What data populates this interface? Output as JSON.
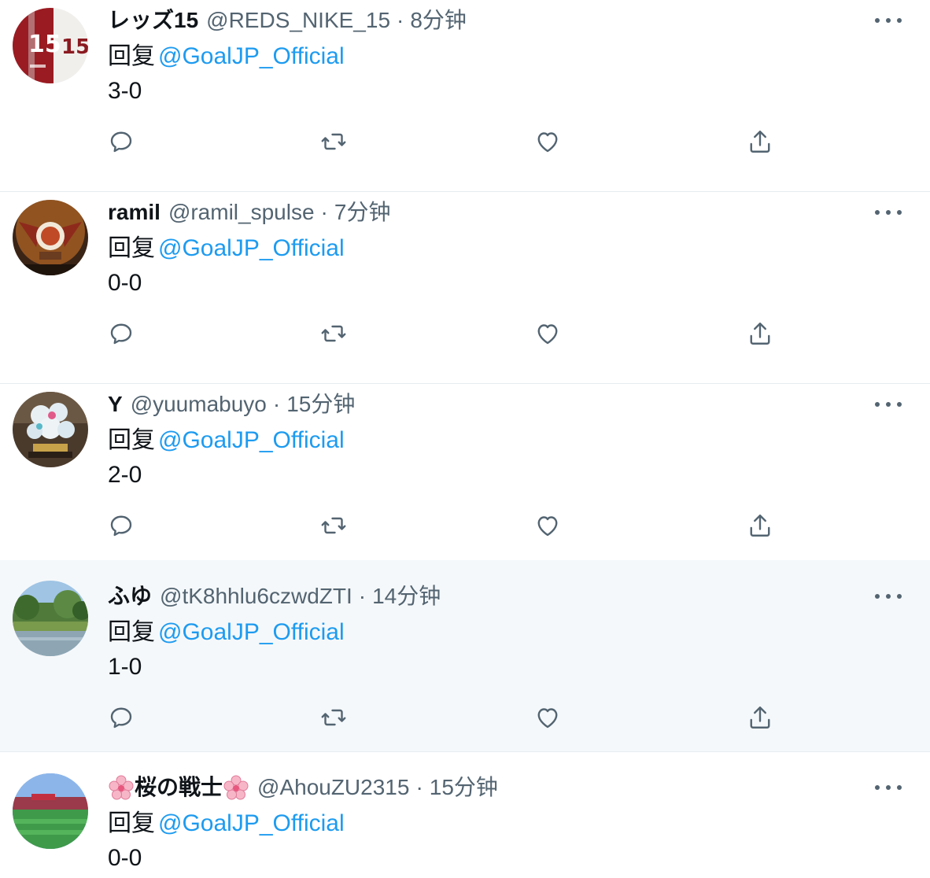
{
  "reply_prefix": "回复",
  "tweets": [
    {
      "display_name": "レッズ15",
      "handle": "@REDS_NIKE_15",
      "time": "8分钟",
      "mention": "@GoalJP_Official",
      "text": "3-0",
      "avatar_icon": "jersey-avatar"
    },
    {
      "display_name": "ramil",
      "handle": "@ramil_spulse",
      "time": "7分钟",
      "mention": "@GoalJP_Official",
      "text": "0-0",
      "avatar_icon": "crest-avatar"
    },
    {
      "display_name": "Y",
      "handle": "@yuumabuyo",
      "time": "15分钟",
      "mention": "@GoalJP_Official",
      "text": "2-0",
      "avatar_icon": "figurine-avatar"
    },
    {
      "display_name": "ふゆ",
      "handle": "@tK8hhlu6czwdZTI",
      "time": "14分钟",
      "mention": "@GoalJP_Official",
      "text": "1-0",
      "avatar_icon": "landscape-avatar"
    },
    {
      "display_name": "桜の戦士",
      "handle": "@AhouZU2315",
      "time": "15分钟",
      "mention": "@GoalJP_Official",
      "text": "0-0",
      "avatar_icon": "stadium-avatar",
      "name_decoration_icon": "cherry-blossom-icon"
    }
  ],
  "colors": {
    "link": "#1d9bf0",
    "secondary_text": "#536471",
    "hover_background": "#f5f8fa",
    "divider": "#e6ecf0"
  }
}
